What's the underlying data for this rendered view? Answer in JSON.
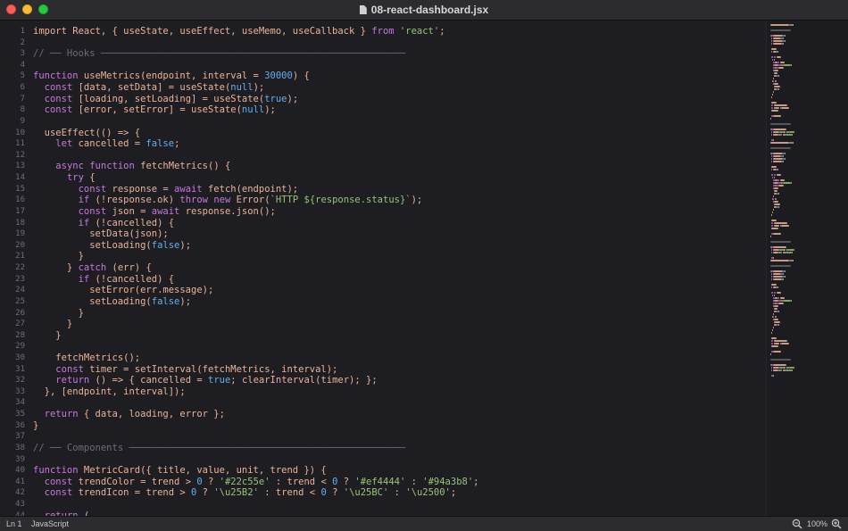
{
  "window": {
    "title": "08-react-dashboard.jsx",
    "file_icon": "document-icon",
    "buttons": [
      "close",
      "minimize",
      "zoom"
    ]
  },
  "colors": {
    "background": "#1e1e22",
    "keyword": "#c678dd",
    "builtin": "#61afef",
    "string": "#98c379",
    "comment": "#6c6c74",
    "text": "#e8b39a"
  },
  "code": {
    "lines": [
      [
        [
          "t",
          "import React, { useState, useEffect, useMemo, useCallback } "
        ],
        [
          "kw",
          "from"
        ],
        [
          "t",
          " "
        ],
        [
          "st",
          "'react'"
        ],
        [
          "t",
          ";"
        ]
      ],
      [],
      [
        [
          "cm",
          "// ── Hooks ──────────────────────────────────────────────────────"
        ]
      ],
      [],
      [
        [
          "kw",
          "function"
        ],
        [
          "t",
          " useMetrics(endpoint, interval = "
        ],
        [
          "nb",
          "30000"
        ],
        [
          "t",
          ") {"
        ]
      ],
      [
        [
          "t",
          "  "
        ],
        [
          "kw",
          "const"
        ],
        [
          "t",
          " [data, setData] = useState("
        ],
        [
          "nb",
          "null"
        ],
        [
          "t",
          ");"
        ]
      ],
      [
        [
          "t",
          "  "
        ],
        [
          "kw",
          "const"
        ],
        [
          "t",
          " [loading, setLoading] = useState("
        ],
        [
          "nb",
          "true"
        ],
        [
          "t",
          ");"
        ]
      ],
      [
        [
          "t",
          "  "
        ],
        [
          "kw",
          "const"
        ],
        [
          "t",
          " [error, setError] = useState("
        ],
        [
          "nb",
          "null"
        ],
        [
          "t",
          ");"
        ]
      ],
      [],
      [
        [
          "t",
          "  useEffect(() => {"
        ]
      ],
      [
        [
          "t",
          "    "
        ],
        [
          "kw",
          "let"
        ],
        [
          "t",
          " cancelled = "
        ],
        [
          "nb",
          "false"
        ],
        [
          "t",
          ";"
        ]
      ],
      [],
      [
        [
          "t",
          "    "
        ],
        [
          "kw",
          "async"
        ],
        [
          "t",
          " "
        ],
        [
          "kw",
          "function"
        ],
        [
          "t",
          " fetchMetrics() {"
        ]
      ],
      [
        [
          "t",
          "      "
        ],
        [
          "kw",
          "try"
        ],
        [
          "t",
          " {"
        ]
      ],
      [
        [
          "t",
          "        "
        ],
        [
          "kw",
          "const"
        ],
        [
          "t",
          " response = "
        ],
        [
          "kw",
          "await"
        ],
        [
          "t",
          " fetch(endpoint);"
        ]
      ],
      [
        [
          "t",
          "        "
        ],
        [
          "kw",
          "if"
        ],
        [
          "t",
          " (!response.ok) "
        ],
        [
          "kw",
          "throw"
        ],
        [
          "t",
          " "
        ],
        [
          "kw",
          "new"
        ],
        [
          "t",
          " Error("
        ],
        [
          "st",
          "`HTTP ${response.status}`"
        ],
        [
          "t",
          ");"
        ]
      ],
      [
        [
          "t",
          "        "
        ],
        [
          "kw",
          "const"
        ],
        [
          "t",
          " json = "
        ],
        [
          "kw",
          "await"
        ],
        [
          "t",
          " response.json();"
        ]
      ],
      [
        [
          "t",
          "        "
        ],
        [
          "kw",
          "if"
        ],
        [
          "t",
          " (!cancelled) {"
        ]
      ],
      [
        [
          "t",
          "          setData(json);"
        ]
      ],
      [
        [
          "t",
          "          setLoading("
        ],
        [
          "nb",
          "false"
        ],
        [
          "t",
          ");"
        ]
      ],
      [
        [
          "t",
          "        }"
        ]
      ],
      [
        [
          "t",
          "      } "
        ],
        [
          "kw",
          "catch"
        ],
        [
          "t",
          " (err) {"
        ]
      ],
      [
        [
          "t",
          "        "
        ],
        [
          "kw",
          "if"
        ],
        [
          "t",
          " (!cancelled) {"
        ]
      ],
      [
        [
          "t",
          "          setError(err.message);"
        ]
      ],
      [
        [
          "t",
          "          setLoading("
        ],
        [
          "nb",
          "false"
        ],
        [
          "t",
          ");"
        ]
      ],
      [
        [
          "t",
          "        }"
        ]
      ],
      [
        [
          "t",
          "      }"
        ]
      ],
      [
        [
          "t",
          "    }"
        ]
      ],
      [],
      [
        [
          "t",
          "    fetchMetrics();"
        ]
      ],
      [
        [
          "t",
          "    "
        ],
        [
          "kw",
          "const"
        ],
        [
          "t",
          " timer = setInterval(fetchMetrics, interval);"
        ]
      ],
      [
        [
          "t",
          "    "
        ],
        [
          "kw",
          "return"
        ],
        [
          "t",
          " () => { cancelled = "
        ],
        [
          "nb",
          "true"
        ],
        [
          "t",
          "; clearInterval(timer); };"
        ]
      ],
      [
        [
          "t",
          "  }, [endpoint, interval]);"
        ]
      ],
      [],
      [
        [
          "t",
          "  "
        ],
        [
          "kw",
          "return"
        ],
        [
          "t",
          " { data, loading, error };"
        ]
      ],
      [
        [
          "t",
          "}"
        ]
      ],
      [],
      [
        [
          "cm",
          "// ── Components ─────────────────────────────────────────────────"
        ]
      ],
      [],
      [
        [
          "kw",
          "function"
        ],
        [
          "t",
          " MetricCard({ title, value, unit, trend }) {"
        ]
      ],
      [
        [
          "t",
          "  "
        ],
        [
          "kw",
          "const"
        ],
        [
          "t",
          " trendColor = trend > "
        ],
        [
          "nb",
          "0"
        ],
        [
          "t",
          " ? "
        ],
        [
          "st",
          "'#22c55e'"
        ],
        [
          "t",
          " : trend < "
        ],
        [
          "nb",
          "0"
        ],
        [
          "t",
          " ? "
        ],
        [
          "st",
          "'#ef4444'"
        ],
        [
          "t",
          " : "
        ],
        [
          "st",
          "'#94a3b8'"
        ],
        [
          "t",
          ";"
        ]
      ],
      [
        [
          "t",
          "  "
        ],
        [
          "kw",
          "const"
        ],
        [
          "t",
          " trendIcon = trend > "
        ],
        [
          "nb",
          "0"
        ],
        [
          "t",
          " ? "
        ],
        [
          "st",
          "'\\u25B2'"
        ],
        [
          "t",
          " : trend < "
        ],
        [
          "nb",
          "0"
        ],
        [
          "t",
          " ? "
        ],
        [
          "st",
          "'\\u25BC'"
        ],
        [
          "t",
          " : "
        ],
        [
          "st",
          "'\\u2500'"
        ],
        [
          "t",
          ";"
        ]
      ],
      [],
      [
        [
          "t",
          "  "
        ],
        [
          "kw",
          "return"
        ],
        [
          "t",
          " ("
        ]
      ]
    ]
  },
  "status": {
    "position": "Ln 1",
    "language": "JavaScript",
    "zoom": "100%",
    "zoom_out_icon": "zoom-out-icon",
    "zoom_in_icon": "zoom-in-icon"
  }
}
